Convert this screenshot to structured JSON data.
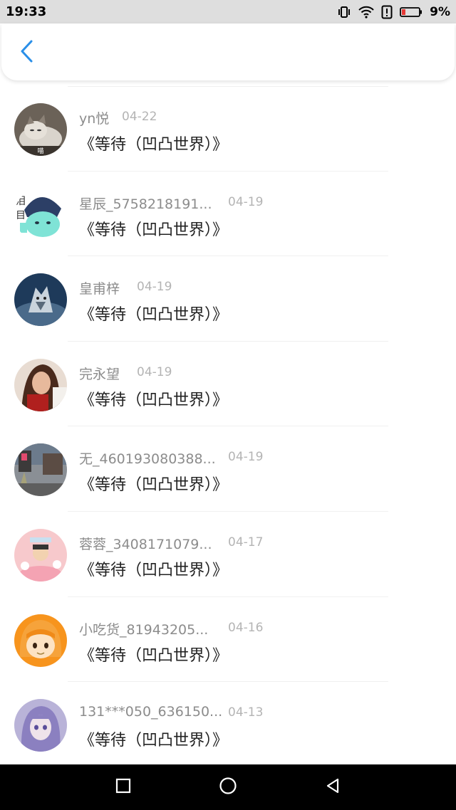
{
  "status_bar": {
    "time": "19:33",
    "battery_percent": "9%",
    "icons": [
      "vibrate-icon",
      "wifi-icon",
      "alert-icon",
      "battery-low-icon"
    ],
    "battery_color": "#e53935"
  },
  "header": {
    "back_icon": "chevron-left-icon",
    "accent_color": "#2a8fe8"
  },
  "items": [
    {
      "name": "yn悦",
      "date": "04-22",
      "title": "《等待（凹凸世界）》",
      "avatar": "cat-avatar"
    },
    {
      "name": "星辰_5758218191...",
      "date": "04-19",
      "title": "《等待（凹凸世界）》",
      "avatar": "anime-blue-avatar"
    },
    {
      "name": "皇甫梓",
      "date": "04-19",
      "title": "《等待（凹凸世界）》",
      "avatar": "wolf-avatar"
    },
    {
      "name": "完永望",
      "date": "04-19",
      "title": "《等待（凹凸世界）》",
      "avatar": "woman-avatar"
    },
    {
      "name": "无_460193080388...",
      "date": "04-19",
      "title": "《等待（凹凸世界）》",
      "avatar": "street-avatar"
    },
    {
      "name": "蓉蓉_3408171079...",
      "date": "04-17",
      "title": "《等待（凹凸世界）》",
      "avatar": "pink-cartoon-avatar"
    },
    {
      "name": "小吃货_81943205...",
      "date": "04-16",
      "title": "《等待（凹凸世界）》",
      "avatar": "orange-anime-avatar"
    },
    {
      "name": "131***050_636150...",
      "date": "04-13",
      "title": "《等待（凹凸世界）》",
      "avatar": "purple-girl-avatar"
    }
  ],
  "nav_bar": {
    "icons": [
      "recent-apps-icon",
      "home-icon",
      "back-icon"
    ]
  }
}
